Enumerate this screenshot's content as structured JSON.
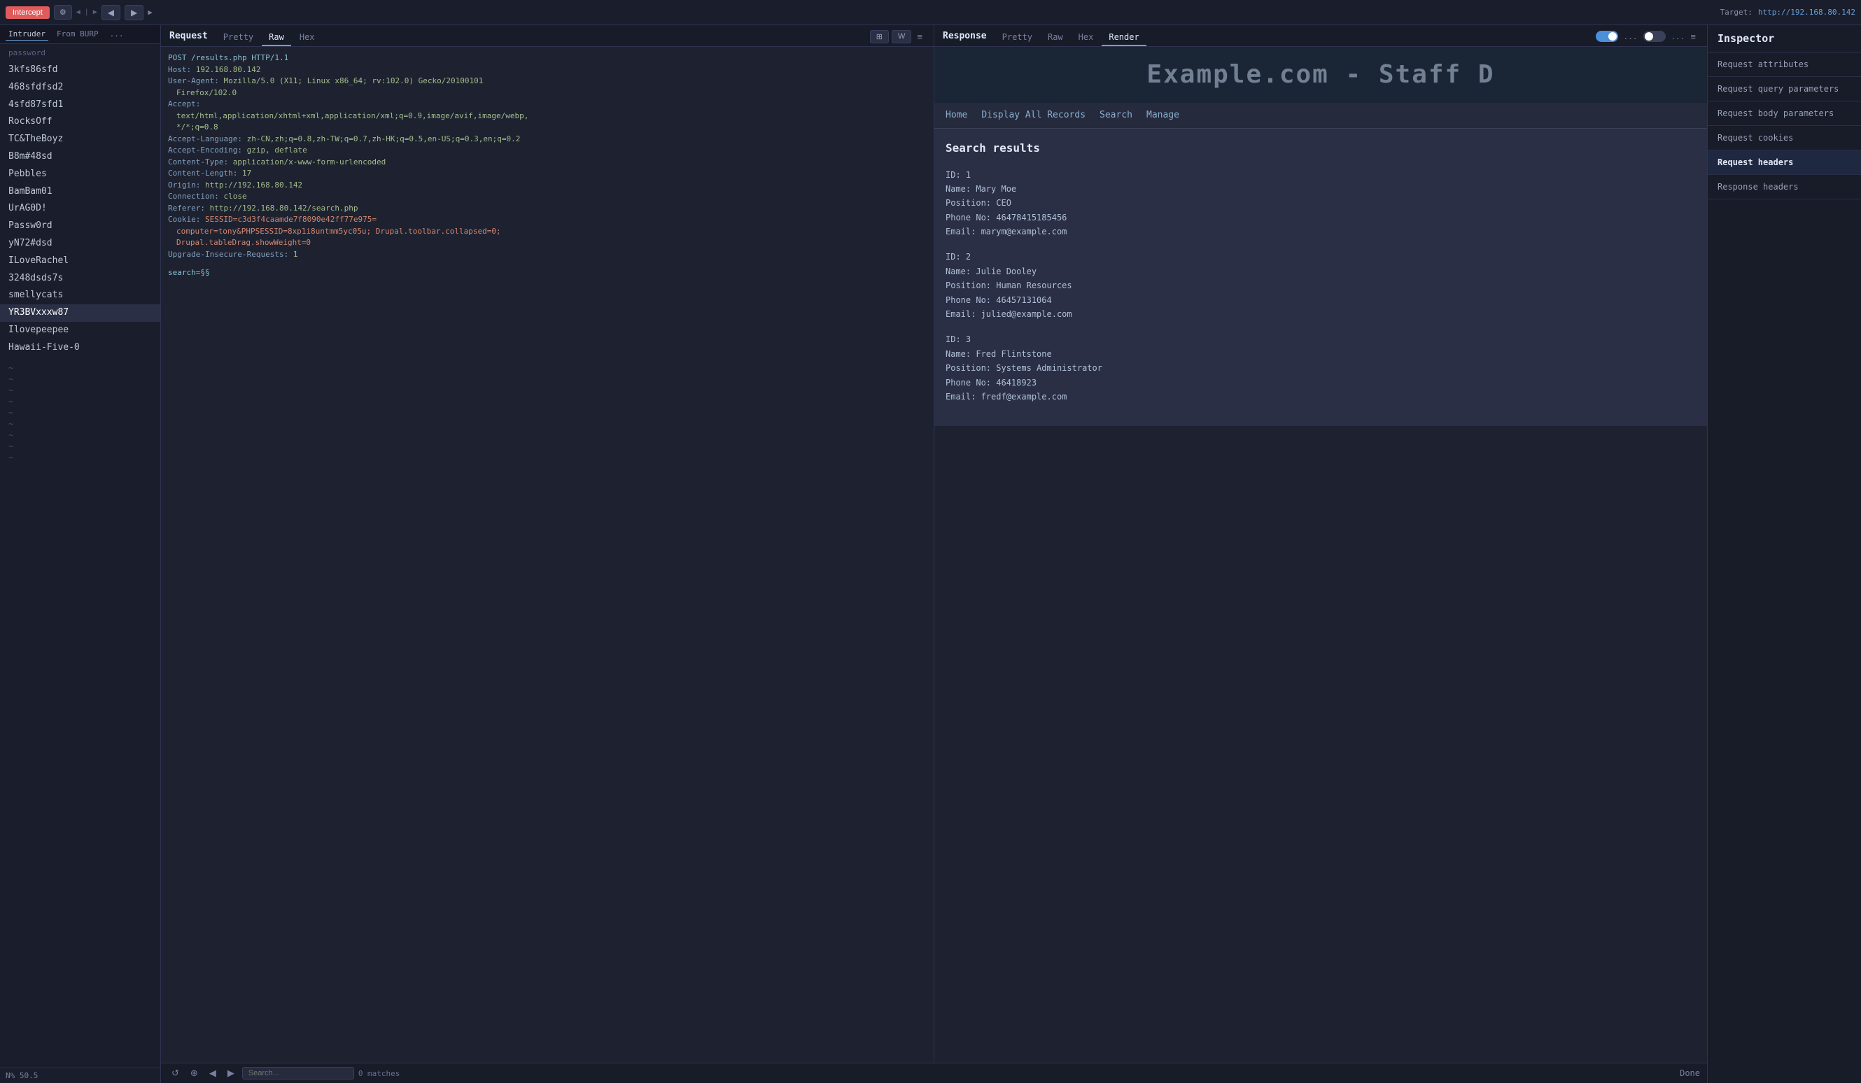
{
  "topbar": {
    "intercept_label": "Intercept",
    "target_label": "Target:",
    "target_url": "http://192.168.80.142",
    "nav_back": "◀",
    "nav_fwd": "▶",
    "nav_sep": "▐"
  },
  "sidebar": {
    "tabs": [
      "Intruder",
      "From BURP",
      "..."
    ],
    "section_label": "password",
    "items": [
      "3kfs86sfd",
      "468sfdfsd2",
      "4sfd87sfd1",
      "RocksOff",
      "TC&TheBoyz",
      "B8m#48sd",
      "Pebbles",
      "BamBam01",
      "UrAG0D!",
      "Passw0rd",
      "yN72#dsd",
      "ILoveRachel",
      "3248dsds7s",
      "smellycats",
      "YR3BVxxxw87",
      "Ilovepeepee",
      "Hawaii-Five-0"
    ],
    "tildes": [
      "~",
      "~",
      "~",
      "~",
      "~",
      "~",
      "~",
      "~",
      "~"
    ]
  },
  "request": {
    "panel_title": "Request",
    "tabs": [
      "Pretty",
      "Raw",
      "Hex"
    ],
    "active_tab": "Raw",
    "action_icons": [
      "⊞",
      "W",
      "≡"
    ],
    "lines": [
      "POST /results.php HTTP/1.1",
      "Host: 192.168.80.142",
      "User-Agent: Mozilla/5.0 (X11; Linux x86_64; rv:102.0) Gecko/20100101",
      "Firefox/102.0",
      "Accept:",
      "text/html,application/xhtml+xml,application/xml;q=0.9,image/avif,image/webp,",
      "*/*;q=0.8",
      "Accept-Language: zh-CN,zh;q=0.8,zh-TW;q=0.7,zh-HK;q=0.5,en-US;q=0.3,en;q=0.2",
      "Accept-Encoding: gzip, deflate",
      "Content-Type: application/x-www-form-urlencoded",
      "Content-Length: 17",
      "Origin: http://192.168.80.142",
      "Connection: close",
      "Referer: http://192.168.80.142/search.php",
      "Cookie: SESSID=c3d3f4caamde7f8090e42ff77e975=",
      "computer=tony&PHPSESSID=8xp1i8untmm5yc05u; Drupal.toolbar.collapsed=0;",
      "Drupal.tableDrag.showWeight=0",
      "Upgrade-Insecure-Requests: 1",
      "",
      "search=§§"
    ],
    "search_placeholder": "Search...",
    "matches_label": "0 matches"
  },
  "response": {
    "panel_title": "Response",
    "tabs": [
      "Pretty",
      "Raw",
      "Hex",
      "Render"
    ],
    "active_tab": "Render",
    "action_icons": [
      "≡"
    ],
    "site_header_text": "Example.com - Staff D",
    "nav_items": [
      "Home",
      "Display All Records",
      "Search",
      "Manage"
    ],
    "search_results_title": "Search results",
    "results": [
      {
        "id": "ID: 1",
        "name": "Name: Mary Moe",
        "position": "Position: CEO",
        "phone": "Phone No: 46478415185456",
        "email": "Email: marym@example.com"
      },
      {
        "id": "ID: 2",
        "name": "Name: Julie Dooley",
        "position": "Position: Human Resources",
        "phone": "Phone No: 46457131064",
        "email": "Email: julied@example.com"
      },
      {
        "id": "ID: 3",
        "name": "Name: Fred Flintstone",
        "position": "Position: Systems Administrator",
        "phone": "Phone No: 46418923",
        "email": "Email: fredf@example.com"
      }
    ],
    "toggle_label1": "...",
    "toggle_label2": "..."
  },
  "inspector": {
    "title": "Inspector",
    "sections": [
      "Request attributes",
      "Request query parameters",
      "Request body parameters",
      "Request cookies",
      "Request headers",
      "Response headers"
    ],
    "highlighted_section": "Request headers"
  },
  "bottom": {
    "done_label": "Done",
    "matches_label": "0 matches"
  }
}
